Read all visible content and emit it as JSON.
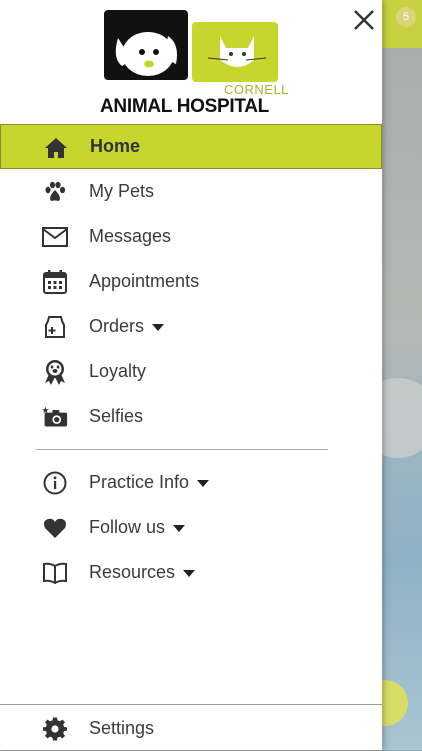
{
  "background": {
    "badge_count": "5"
  },
  "brand": {
    "line1": "CORNELL",
    "line2": "ANIMAL HOSPITAL",
    "accent": "#c6d62c"
  },
  "menu": [
    {
      "label": "Home",
      "icon": "home-icon",
      "active": true
    },
    {
      "label": "My Pets",
      "icon": "paw-icon"
    },
    {
      "label": "Messages",
      "icon": "envelope-icon"
    },
    {
      "label": "Appointments",
      "icon": "calendar-icon"
    },
    {
      "label": "Orders",
      "icon": "bag-icon",
      "dropdown": true
    },
    {
      "label": "Loyalty",
      "icon": "award-icon"
    },
    {
      "label": "Selfies",
      "icon": "camera-icon"
    }
  ],
  "menu2": [
    {
      "label": "Practice Info",
      "icon": "info-icon",
      "dropdown": true
    },
    {
      "label": "Follow us",
      "icon": "heart-icon",
      "dropdown": true
    },
    {
      "label": "Resources",
      "icon": "book-icon",
      "dropdown": true
    }
  ],
  "settings": {
    "label": "Settings",
    "icon": "gear-icon"
  }
}
